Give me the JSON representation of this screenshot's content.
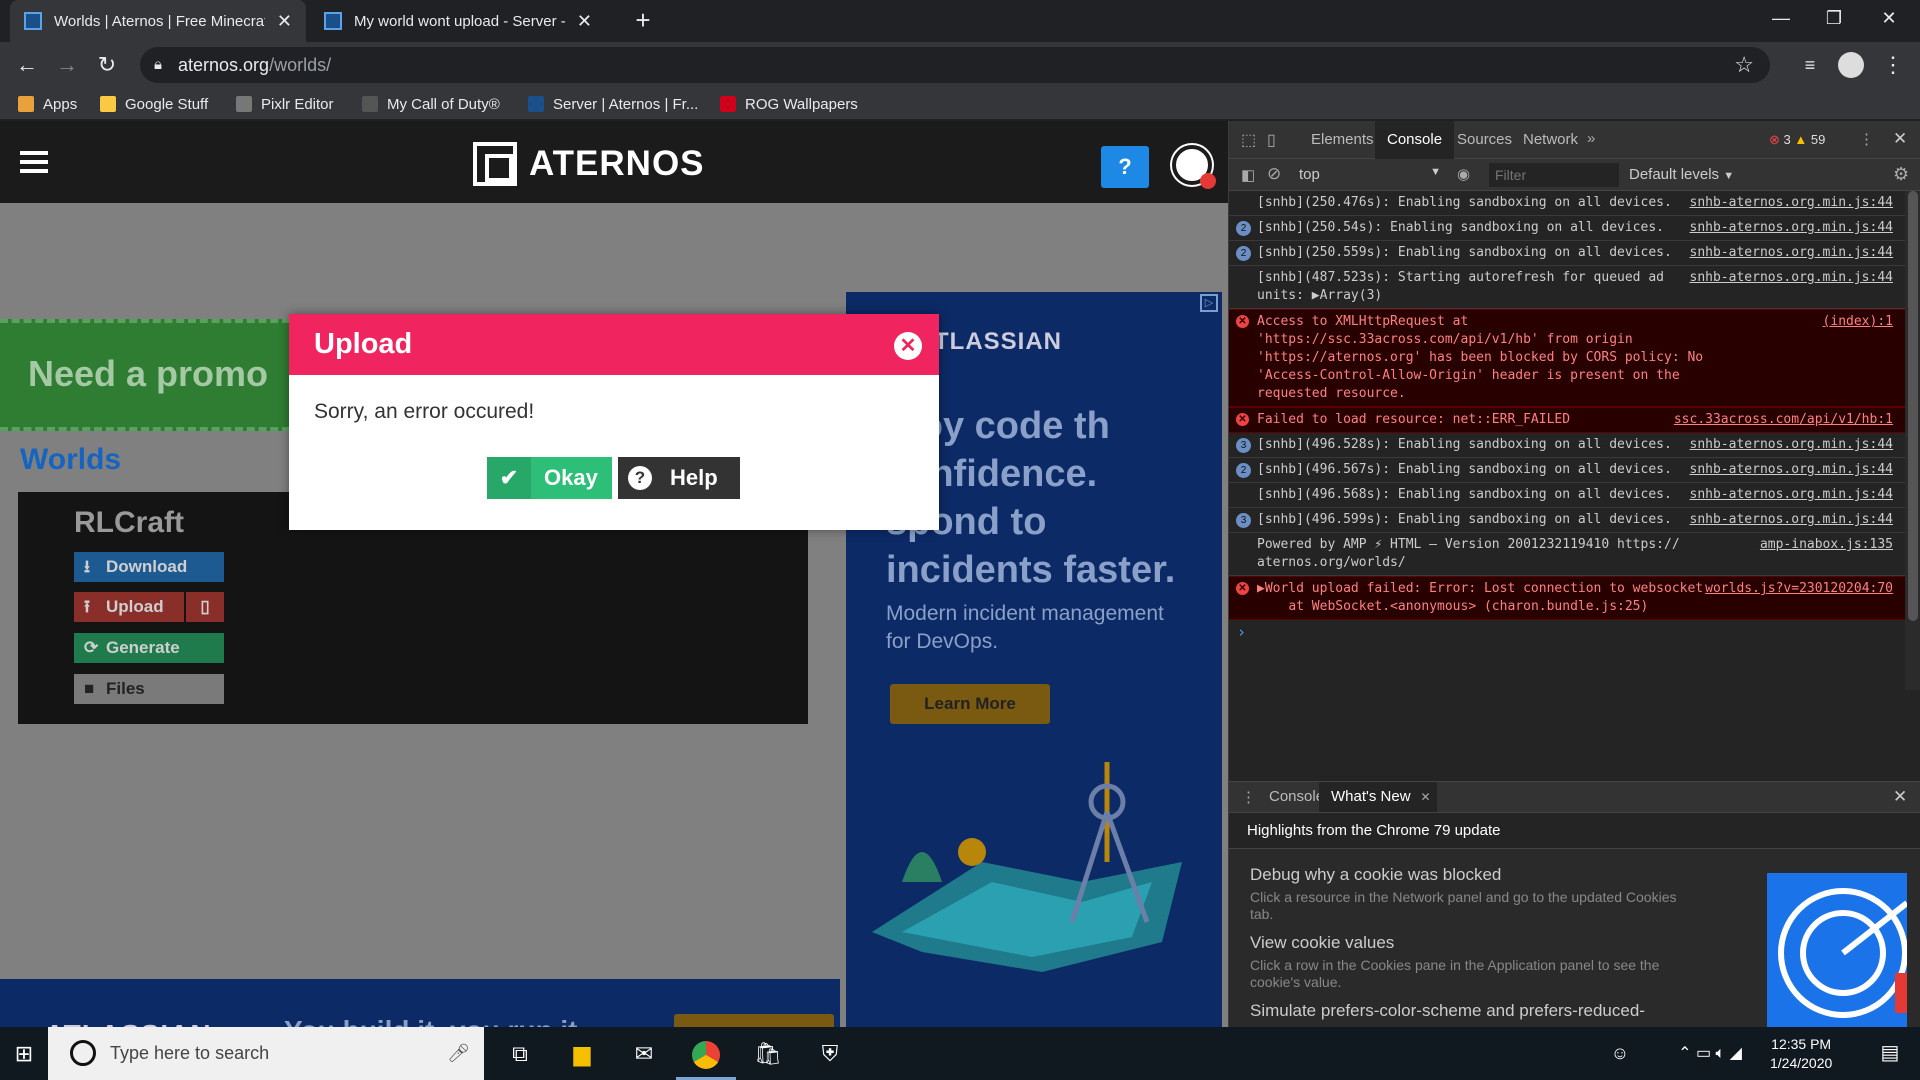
{
  "browser": {
    "tabs": [
      {
        "title": "Worlds | Aternos | Free Minecraft"
      },
      {
        "title": "My world wont upload - Server -"
      }
    ],
    "url_domain": "aternos.org",
    "url_path": "/worlds/",
    "bookmarks": [
      {
        "label": "Apps",
        "color": "#e9a23b"
      },
      {
        "label": "Google Stuff",
        "color": "#f9c944"
      },
      {
        "label": "Pixlr Editor",
        "color": "#777777"
      },
      {
        "label": "My Call of Duty®",
        "color": "#555555"
      },
      {
        "label": "Server | Aternos | Fr...",
        "color": "#1a4f8a"
      },
      {
        "label": "ROG Wallpapers",
        "color": "#d0021b"
      }
    ]
  },
  "site": {
    "logo": "ATERNOS",
    "help_glyph": "?",
    "promo": "Need a promo",
    "worlds_heading": "Worlds",
    "world_name": "RLCraft",
    "actions": [
      {
        "label": "Download",
        "color": "#1e88e5",
        "icon": "download-icon"
      },
      {
        "label": "Upload",
        "color": "#e53935",
        "icon": "upload-icon"
      },
      {
        "label": "Generate",
        "color": "#2dbf78",
        "icon": "refresh-icon"
      },
      {
        "label": "Files",
        "color": "#ffffff",
        "icon": "folder-icon"
      }
    ],
    "ad_right": {
      "brand": "TLASSIAN",
      "headline": "ploy code th confidence. spond to incidents faster.",
      "sub": "Modern incident management for DevOps.",
      "cta": "Learn More"
    },
    "ad_bottom": {
      "brand": "ATLASSIAN",
      "tagline": "You build it, you run it.",
      "cta": "Learn More"
    }
  },
  "dialog": {
    "title": "Upload",
    "message": "Sorry, an error occured!",
    "okay_label": "Okay",
    "help_label": "Help"
  },
  "devtools": {
    "tabs": [
      "Elements",
      "Console",
      "Sources",
      "Network"
    ],
    "active_tab": "Console",
    "error_count": "3",
    "warning_count": "59",
    "context": "top",
    "filter_placeholder": "Filter",
    "levels": "Default levels",
    "messages": [
      {
        "text": "[snhb](250.476s): Enabling sandboxing on all devices.",
        "source": "snhb-aternos.org.min.js:44",
        "count": "",
        "error": false
      },
      {
        "text": "[snhb](250.54s): Enabling sandboxing on all devices.",
        "source": "snhb-aternos.org.min.js:44",
        "count": "2",
        "error": false
      },
      {
        "text": "[snhb](250.559s): Enabling sandboxing on all devices.",
        "source": "snhb-aternos.org.min.js:44",
        "count": "2",
        "error": false
      },
      {
        "text": "[snhb](487.523s): Starting autorefresh for queued ad units: ▶Array(3)",
        "source": "snhb-aternos.org.min.js:44",
        "count": "",
        "error": false
      },
      {
        "text": "Access to XMLHttpRequest at 'https://ssc.33across.com/api/v1/hb' from origin 'https://aternos.org' has been blocked by CORS policy: No 'Access-Control-Allow-Origin' header is present on the requested resource.",
        "source": "(index):1",
        "count": "",
        "error": true
      },
      {
        "text": "Failed to load resource: net::ERR_FAILED",
        "source": "ssc.33across.com/api/v1/hb:1",
        "count": "",
        "error": true
      },
      {
        "text": "[snhb](496.528s): Enabling sandboxing on all devices.",
        "source": "snhb-aternos.org.min.js:44",
        "count": "3",
        "error": false
      },
      {
        "text": "[snhb](496.567s): Enabling sandboxing on all devices.",
        "source": "snhb-aternos.org.min.js:44",
        "count": "2",
        "error": false
      },
      {
        "text": "[snhb](496.568s): Enabling sandboxing on all devices.",
        "source": "snhb-aternos.org.min.js:44",
        "count": "",
        "error": false
      },
      {
        "text": "[snhb](496.599s): Enabling sandboxing on all devices.",
        "source": "snhb-aternos.org.min.js:44",
        "count": "3",
        "error": false
      },
      {
        "text": "Powered by AMP ⚡ HTML – Version 2001232119410 https:// aternos.org/worlds/",
        "source": "amp-inabox.js:135",
        "count": "",
        "error": false
      },
      {
        "text": "▶World upload failed: Error: Lost connection to websocket\n    at WebSocket.<anonymous> (charon.bundle.js:25)",
        "source": "worlds.js?v=230120204:70",
        "count": "",
        "error": true
      }
    ],
    "prompt": "›",
    "drawer_tabs": [
      "Console",
      "What's New"
    ],
    "drawer_heading": "Highlights from the Chrome 79 update",
    "news": [
      {
        "title": "Debug why a cookie was blocked",
        "desc": "Click a resource in the Network panel and go to the updated Cookies tab."
      },
      {
        "title": "View cookie values",
        "desc": "Click a row in the Cookies pane in the Application panel to see the cookie's value."
      },
      {
        "title": "Simulate prefers-color-scheme and prefers-reduced-",
        "desc": ""
      }
    ]
  },
  "taskbar": {
    "search_placeholder": "Type here to search",
    "time": "12:35 PM",
    "date": "1/24/2020"
  }
}
